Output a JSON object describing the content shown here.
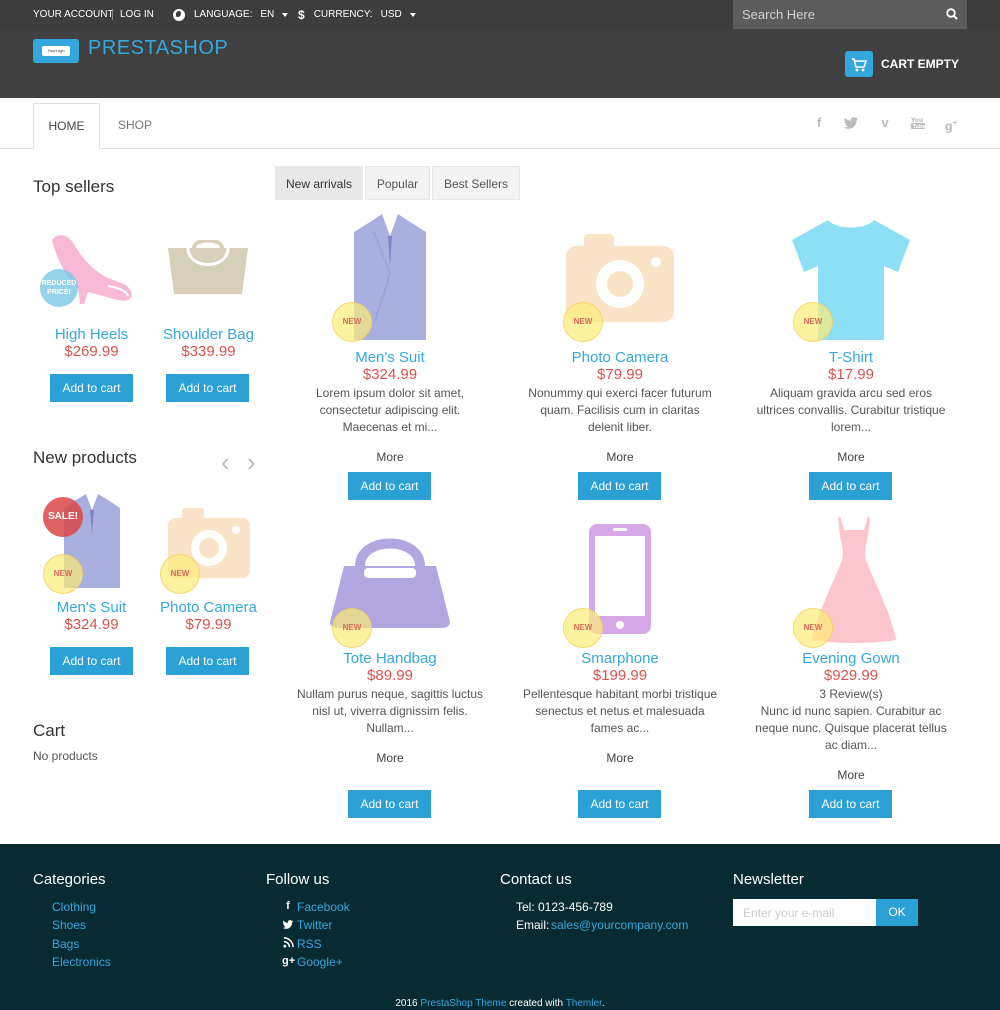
{
  "topbar": {
    "account": "YOUR ACCOUNT",
    "login": "LOG IN",
    "language_label": "LANGUAGE:",
    "language_value": "EN",
    "currency_label": "CURRENCY:",
    "currency_value": "USD",
    "search_placeholder": "Search Here"
  },
  "header": {
    "logo_badge": "YourLogo",
    "logo_text": "PRESTASHOP",
    "cart": "CART EMPTY"
  },
  "nav": {
    "tabs": [
      {
        "label": "HOME",
        "active": true
      },
      {
        "label": "SHOP",
        "active": false
      }
    ],
    "social": [
      "facebook-icon",
      "twitter-icon",
      "vimeo-icon",
      "youtube-icon",
      "google-plus-icon"
    ]
  },
  "sidebar": {
    "top_sellers_title": "Top sellers",
    "top_sellers": [
      {
        "name": "High Heels",
        "price": "$269.99",
        "badge": "REDUCED PRICE!",
        "button": "Add to cart"
      },
      {
        "name": "Shoulder Bag",
        "price": "$339.99",
        "badge": "",
        "button": "Add to cart"
      }
    ],
    "new_products_title": "New products",
    "new_products": [
      {
        "name": "Men's Suit",
        "price": "$324.99",
        "badge_new": "NEW",
        "badge_sale": "SALE!",
        "button": "Add to cart"
      },
      {
        "name": "Photo Camera",
        "price": "$79.99",
        "badge_new": "NEW",
        "badge_sale": "",
        "button": "Add to cart"
      }
    ],
    "cart_title": "Cart",
    "cart_empty": "No products"
  },
  "product_tabs": [
    {
      "label": "New arrivals",
      "active": true
    },
    {
      "label": "Popular",
      "active": false
    },
    {
      "label": "Best Sellers",
      "active": false
    }
  ],
  "products": [
    {
      "name": "Men's Suit",
      "price": "$324.99",
      "badge": "NEW",
      "review": "",
      "desc": "Lorem ipsum dolor sit amet, consectetur adipiscing elit. Maecenas et mi...",
      "more": "More",
      "button": "Add to cart"
    },
    {
      "name": "Photo Camera",
      "price": "$79.99",
      "badge": "NEW",
      "review": "",
      "desc": "Nonummy qui exerci facer futurum quam. Facilisis cum in claritas delenit liber.",
      "more": "More",
      "button": "Add to cart"
    },
    {
      "name": "T-Shirt",
      "price": "$17.99",
      "badge": "NEW",
      "review": "",
      "desc": "Aliquam gravida arcu sed eros ultrices convallis. Curabitur tristique lorem...",
      "more": "More",
      "button": "Add to cart"
    },
    {
      "name": "Tote Handbag",
      "price": "$89.99",
      "badge": "NEW",
      "review": "",
      "desc": "Nullam purus neque, sagittis luctus nisl ut, viverra dignissim felis. Nullam...",
      "more": "More",
      "button": "Add to cart"
    },
    {
      "name": "Smarphone",
      "price": "$199.99",
      "badge": "NEW",
      "review": "",
      "desc": "Pellentesque habitant morbi tristique senectus et netus et malesuada fames ac...",
      "more": "More",
      "button": "Add to cart"
    },
    {
      "name": "Evening Gown",
      "price": "$929.99",
      "badge": "NEW",
      "review": "3 Review(s)",
      "desc": "Nunc id nunc sapien. Curabitur ac neque nunc. Quisque placerat tellus ac diam...",
      "more": "More",
      "button": "Add to cart"
    }
  ],
  "footer": {
    "categories_title": "Categories",
    "categories": [
      "Clothing",
      "Shoes",
      "Bags",
      "Electronics"
    ],
    "follow_title": "Follow us",
    "follow": [
      {
        "icon": "facebook-icon",
        "label": "Facebook"
      },
      {
        "icon": "twitter-icon",
        "label": "Twitter"
      },
      {
        "icon": "rss-icon",
        "label": "RSS"
      },
      {
        "icon": "google-plus-icon",
        "label": "Google+"
      }
    ],
    "contact_title": "Contact us",
    "tel": "Tel: 0123-456-789",
    "email_label": "Email:",
    "email": "sales@yourcompany.com",
    "newsletter_title": "Newsletter",
    "newsletter_placeholder": "Enter your e-mail",
    "newsletter_button": "OK",
    "copyright_year": "2016",
    "copyright_theme": "PrestaShop Theme",
    "copyright_mid": "created with",
    "copyright_tool": "Themler",
    "copyright_end": "."
  },
  "colors": {
    "accent": "#2aa0d5",
    "price": "#d9534f",
    "topbar": "#3d3d3d",
    "header": "#404040",
    "footer": "#082a33"
  }
}
